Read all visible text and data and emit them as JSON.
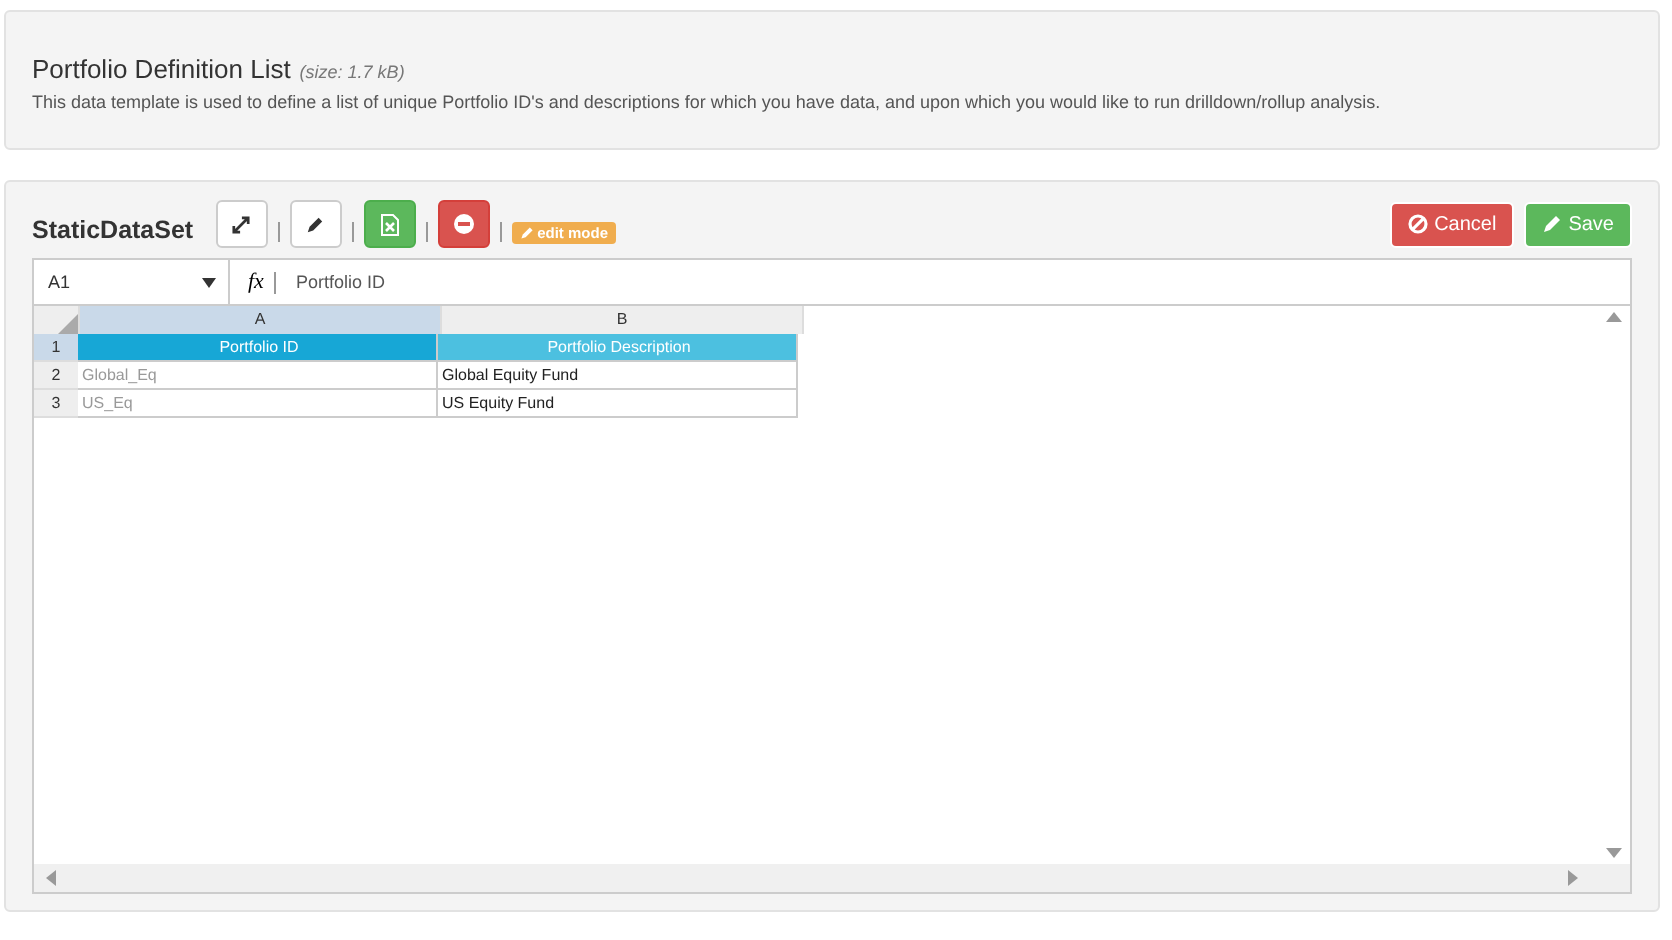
{
  "header": {
    "title": "Portfolio Definition List",
    "size": "(size: 1.7 kB)",
    "description": "This data template is used to define a list of unique Portfolio ID's and descriptions for which you have data, and upon which you would like to run drilldown/rollup analysis."
  },
  "dataset": {
    "title": "StaticDataSet",
    "tools": [
      {
        "kind": "expand"
      },
      {
        "kind": "edit"
      },
      {
        "kind": "excel"
      },
      {
        "kind": "remove"
      }
    ],
    "mode_badge": "edit mode",
    "actions": [
      {
        "kind": "cancel",
        "label": "Cancel"
      },
      {
        "kind": "save",
        "label": "Save"
      }
    ]
  },
  "sheet": {
    "name_box": "A1",
    "function_label": "fx",
    "formula": "Portfolio ID",
    "columns": [
      {
        "label": "A",
        "selected": true
      },
      {
        "label": "B",
        "selected": false
      }
    ],
    "rows": [
      {
        "number": "1",
        "kind": "header",
        "selected": true,
        "cells": [
          {
            "text": "Portfolio ID"
          },
          {
            "text": "Portfolio Description"
          }
        ]
      },
      {
        "number": "2",
        "kind": "data",
        "selected": false,
        "cells": [
          {
            "text": "Global_Eq",
            "muted": true
          },
          {
            "text": "Global Equity Fund",
            "muted": false
          }
        ]
      },
      {
        "number": "3",
        "kind": "data",
        "selected": false,
        "cells": [
          {
            "text": "US_Eq",
            "muted": true
          },
          {
            "text": "US Equity Fund",
            "muted": false
          }
        ]
      }
    ]
  }
}
